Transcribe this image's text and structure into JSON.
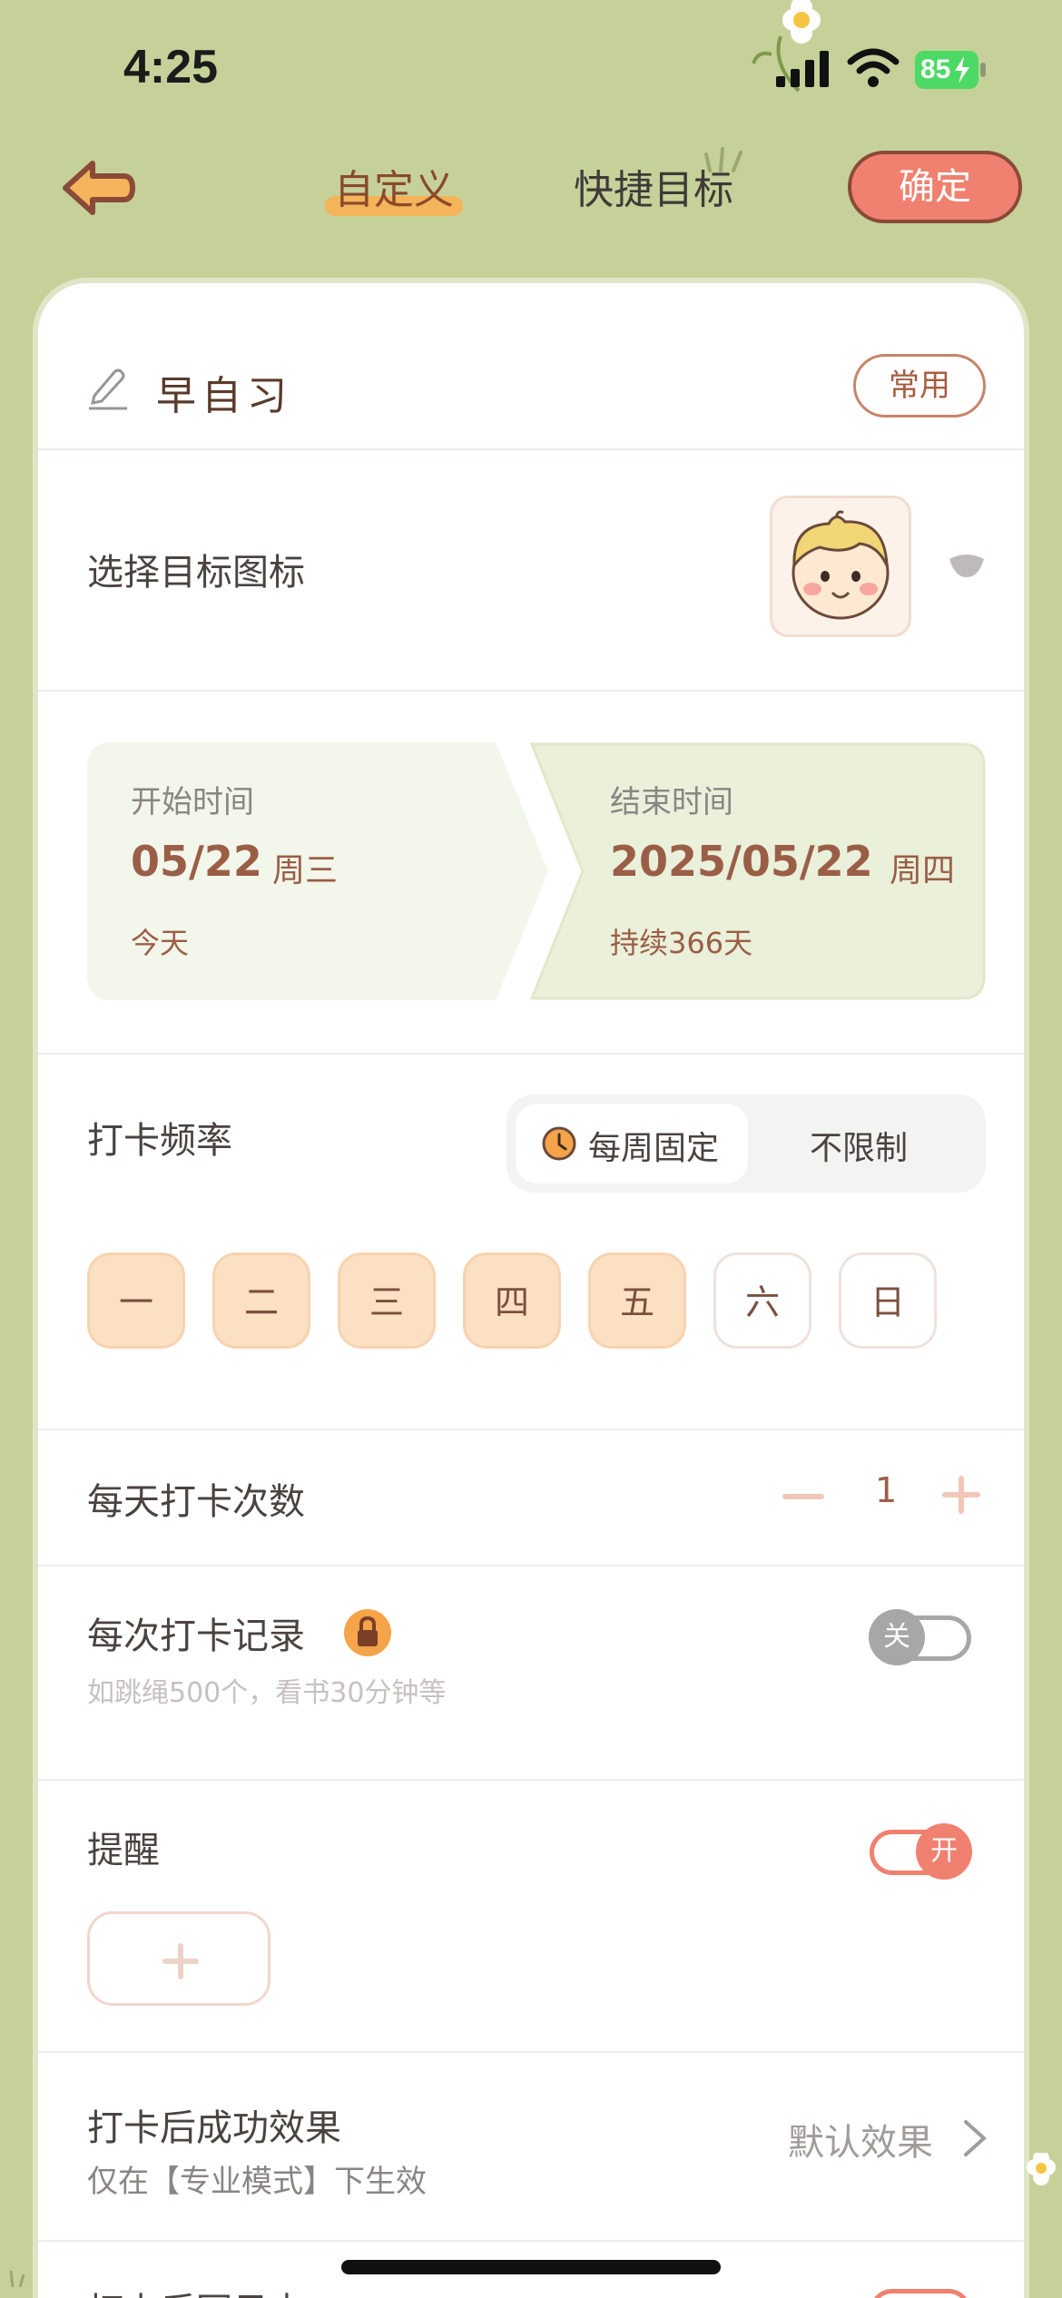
{
  "status_bar": {
    "time": "4:25",
    "battery": "85"
  },
  "header": {
    "tabs": [
      {
        "label": "自定义",
        "selected": true
      },
      {
        "label": "快捷目标",
        "selected": false
      }
    ],
    "confirm_label": "确定"
  },
  "goal": {
    "name": "早自习",
    "common_label": "常用"
  },
  "icon_row": {
    "label": "选择目标图标",
    "icon": "boy-avatar-icon"
  },
  "time_range": {
    "start": {
      "label": "开始时间",
      "date": "05/22",
      "weekday": "周三",
      "sub": "今天"
    },
    "end": {
      "label": "结束时间",
      "date": "2025/05/22",
      "weekday": "周四",
      "sub": "持续366天"
    }
  },
  "frequency": {
    "label": "打卡频率",
    "options": [
      "每周固定",
      "不限制"
    ],
    "selected": "每周固定",
    "days": [
      {
        "label": "一",
        "on": true
      },
      {
        "label": "二",
        "on": true
      },
      {
        "label": "三",
        "on": true
      },
      {
        "label": "四",
        "on": true
      },
      {
        "label": "五",
        "on": true
      },
      {
        "label": "六",
        "on": false
      },
      {
        "label": "日",
        "on": false
      }
    ]
  },
  "daily_count": {
    "label": "每天打卡次数",
    "value": "1"
  },
  "record": {
    "label": "每次打卡记录",
    "hint": "如跳绳500个，看书30分钟等",
    "toggle_label": "关",
    "enabled": false
  },
  "reminder": {
    "label": "提醒",
    "toggle_label": "开",
    "enabled": true
  },
  "success_effect": {
    "label": "打卡后成功效果",
    "hint": "仅在【专业模式】下生效",
    "value": "默认效果"
  },
  "next_row": {
    "label": "打卡后写日志"
  },
  "colors": {
    "background": "#c6d19a",
    "accent": "#f0806f",
    "day_on": "#fbe0c3",
    "tab_underline": "#f5b35a"
  }
}
